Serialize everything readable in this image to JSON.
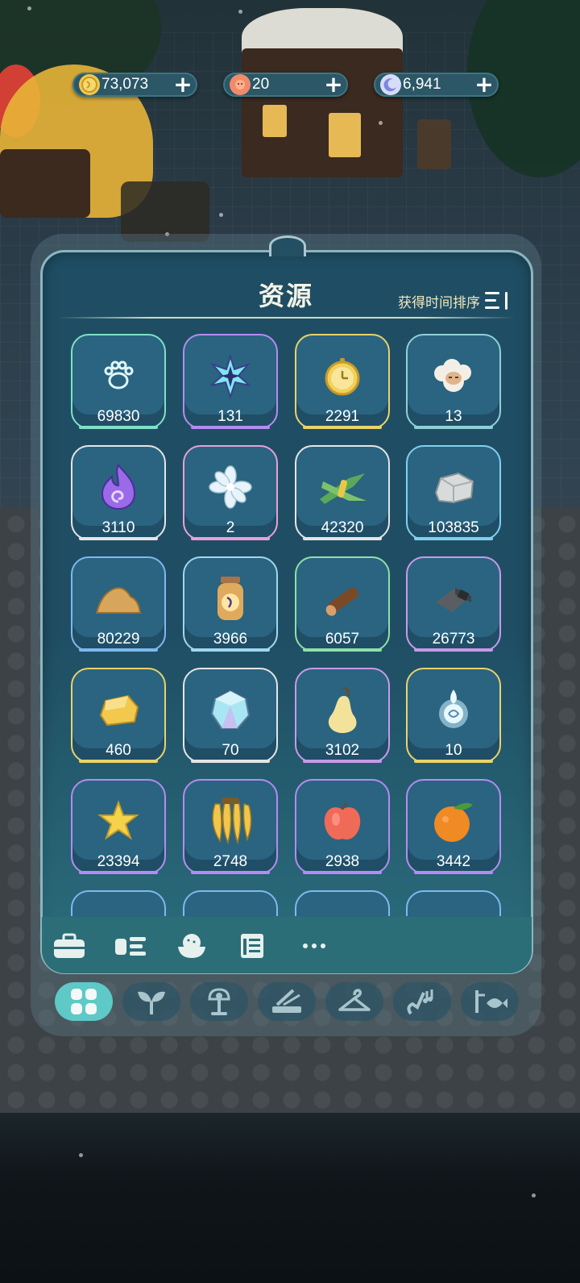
{
  "currency": [
    {
      "icon": "gold-coin-icon",
      "value": "73,073",
      "icon_color": "#f2c94c"
    },
    {
      "icon": "sun-flower-icon",
      "value": "20",
      "icon_color": "#f08a6b"
    },
    {
      "icon": "moon-icon",
      "value": "6,941",
      "icon_color": "#8b9cf2"
    }
  ],
  "panel": {
    "title": "资源",
    "sort_label": "获得时间排序"
  },
  "items": [
    {
      "icon": "paw-print-icon",
      "count": "69830",
      "glow": "#7fe0c8"
    },
    {
      "icon": "star-crystal-icon",
      "count": "131",
      "glow": "#b48cf2"
    },
    {
      "icon": "gold-pocket-watch-icon",
      "count": "2291",
      "glow": "#e9d36a"
    },
    {
      "icon": "sheep-icon",
      "count": "13",
      "glow": "#8fd0d8"
    },
    {
      "icon": "purple-flame-icon",
      "count": "3110",
      "glow": "#e5e5e5"
    },
    {
      "icon": "crystal-flower-icon",
      "count": "2",
      "glow": "#e8a0d8"
    },
    {
      "icon": "grass-bundle-icon",
      "count": "42320",
      "glow": "#e5e5e5"
    },
    {
      "icon": "stone-icon",
      "count": "103835",
      "glow": "#7fd0f0"
    },
    {
      "icon": "sand-pile-icon",
      "count": "80229",
      "glow": "#7fb8f0"
    },
    {
      "icon": "firefly-jar-icon",
      "count": "3966",
      "glow": "#9fd8f0"
    },
    {
      "icon": "wood-log-icon",
      "count": "6057",
      "glow": "#8fe0a8"
    },
    {
      "icon": "iron-ingot-icon",
      "count": "26773",
      "glow": "#c89ae8"
    },
    {
      "icon": "gold-nugget-icon",
      "count": "460",
      "glow": "#e9d36a"
    },
    {
      "icon": "diamond-gem-icon",
      "count": "70",
      "glow": "#e5e5e5"
    },
    {
      "icon": "pear-icon",
      "count": "3102",
      "glow": "#c89ae8"
    },
    {
      "icon": "spirit-orb-icon",
      "count": "10",
      "glow": "#e9d36a"
    },
    {
      "icon": "star-fruit-icon",
      "count": "23394",
      "glow": "#b48cf2"
    },
    {
      "icon": "banana-bunch-icon",
      "count": "2748",
      "glow": "#b48cf2"
    },
    {
      "icon": "red-apple-icon",
      "count": "2938",
      "glow": "#b48cf2"
    },
    {
      "icon": "orange-icon",
      "count": "3442",
      "glow": "#b48cf2"
    },
    {
      "icon": "item-icon",
      "count": "",
      "glow": "#7fb8f0"
    },
    {
      "icon": "item-icon",
      "count": "",
      "glow": "#7fb8f0"
    },
    {
      "icon": "item-icon",
      "count": "",
      "glow": "#7fb8f0"
    },
    {
      "icon": "item-icon",
      "count": "",
      "glow": "#7fb8f0"
    }
  ],
  "sub_toolbar": [
    {
      "icon": "toolbox-icon"
    },
    {
      "icon": "food-icon"
    },
    {
      "icon": "bowl-icon"
    },
    {
      "icon": "music-sheet-icon"
    },
    {
      "icon": "more-dots-icon"
    }
  ],
  "category_tabs": [
    {
      "icon": "grid-icon",
      "active": true
    },
    {
      "icon": "sprout-icon",
      "active": false
    },
    {
      "icon": "furniture-icon",
      "active": false
    },
    {
      "icon": "tools-icon",
      "active": false
    },
    {
      "icon": "hanger-icon",
      "active": false
    },
    {
      "icon": "instrument-icon",
      "active": false
    },
    {
      "icon": "fish-icon",
      "active": false
    }
  ]
}
